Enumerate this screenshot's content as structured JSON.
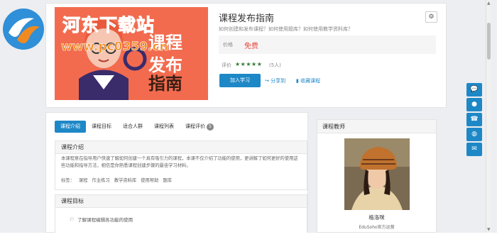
{
  "watermark": {
    "site_name": "河东下载站",
    "url": "www.pc0359.cn",
    "logo_icon": "river-logo-icon"
  },
  "course": {
    "cover_text": [
      "课程",
      "发布",
      "指南"
    ],
    "title": "课程发布指南",
    "subtitle": "如何创建和发布课程？如何使用题库？如何使用教学资料库？",
    "price_label": "价格",
    "price_value": "免费",
    "rating_label": "评价",
    "stars": "★★★★★",
    "rating_count": "(5人)",
    "join_button": "加入学习",
    "share_label": "分享到",
    "favorite_label": "收藏课程",
    "share_icon": "share-icon",
    "favorite_icon": "bookmark-icon",
    "settings_icon": "gear-icon"
  },
  "tabs": [
    {
      "label": "课程介绍"
    },
    {
      "label": "课程目标"
    },
    {
      "label": "适合人群"
    },
    {
      "label": "课程列表"
    },
    {
      "label": "课程评价",
      "badge": "5"
    }
  ],
  "intro": {
    "heading": "课程介绍",
    "text": "本课程意在指导用户快速了解如何创建一个具有吸引力的课程，本课不仅介绍了功能的使用，更讲解了如何更好的使用这些功能和指导方法，相信是你熟悉课程创建步骤的最佳学习材料。",
    "tags_label": "标签：",
    "tags": [
      "课程",
      "作业练习",
      "教学资料库",
      "使用帮助",
      "题库"
    ]
  },
  "goals": {
    "heading": "课程目标",
    "items": [
      "了解课程编辑各功能的使用"
    ]
  },
  "teacher": {
    "heading": "课程教师",
    "name": "格洛咪",
    "org": "EduSoho官方运营"
  },
  "side_tools": [
    "chat-icon",
    "qq-icon",
    "phone-icon",
    "wechat-icon",
    "mail-icon"
  ],
  "colors": {
    "accent": "#1e88c7",
    "price": "#e8463b",
    "star": "#2e7d32",
    "cover_bg": "#f26b4f"
  }
}
